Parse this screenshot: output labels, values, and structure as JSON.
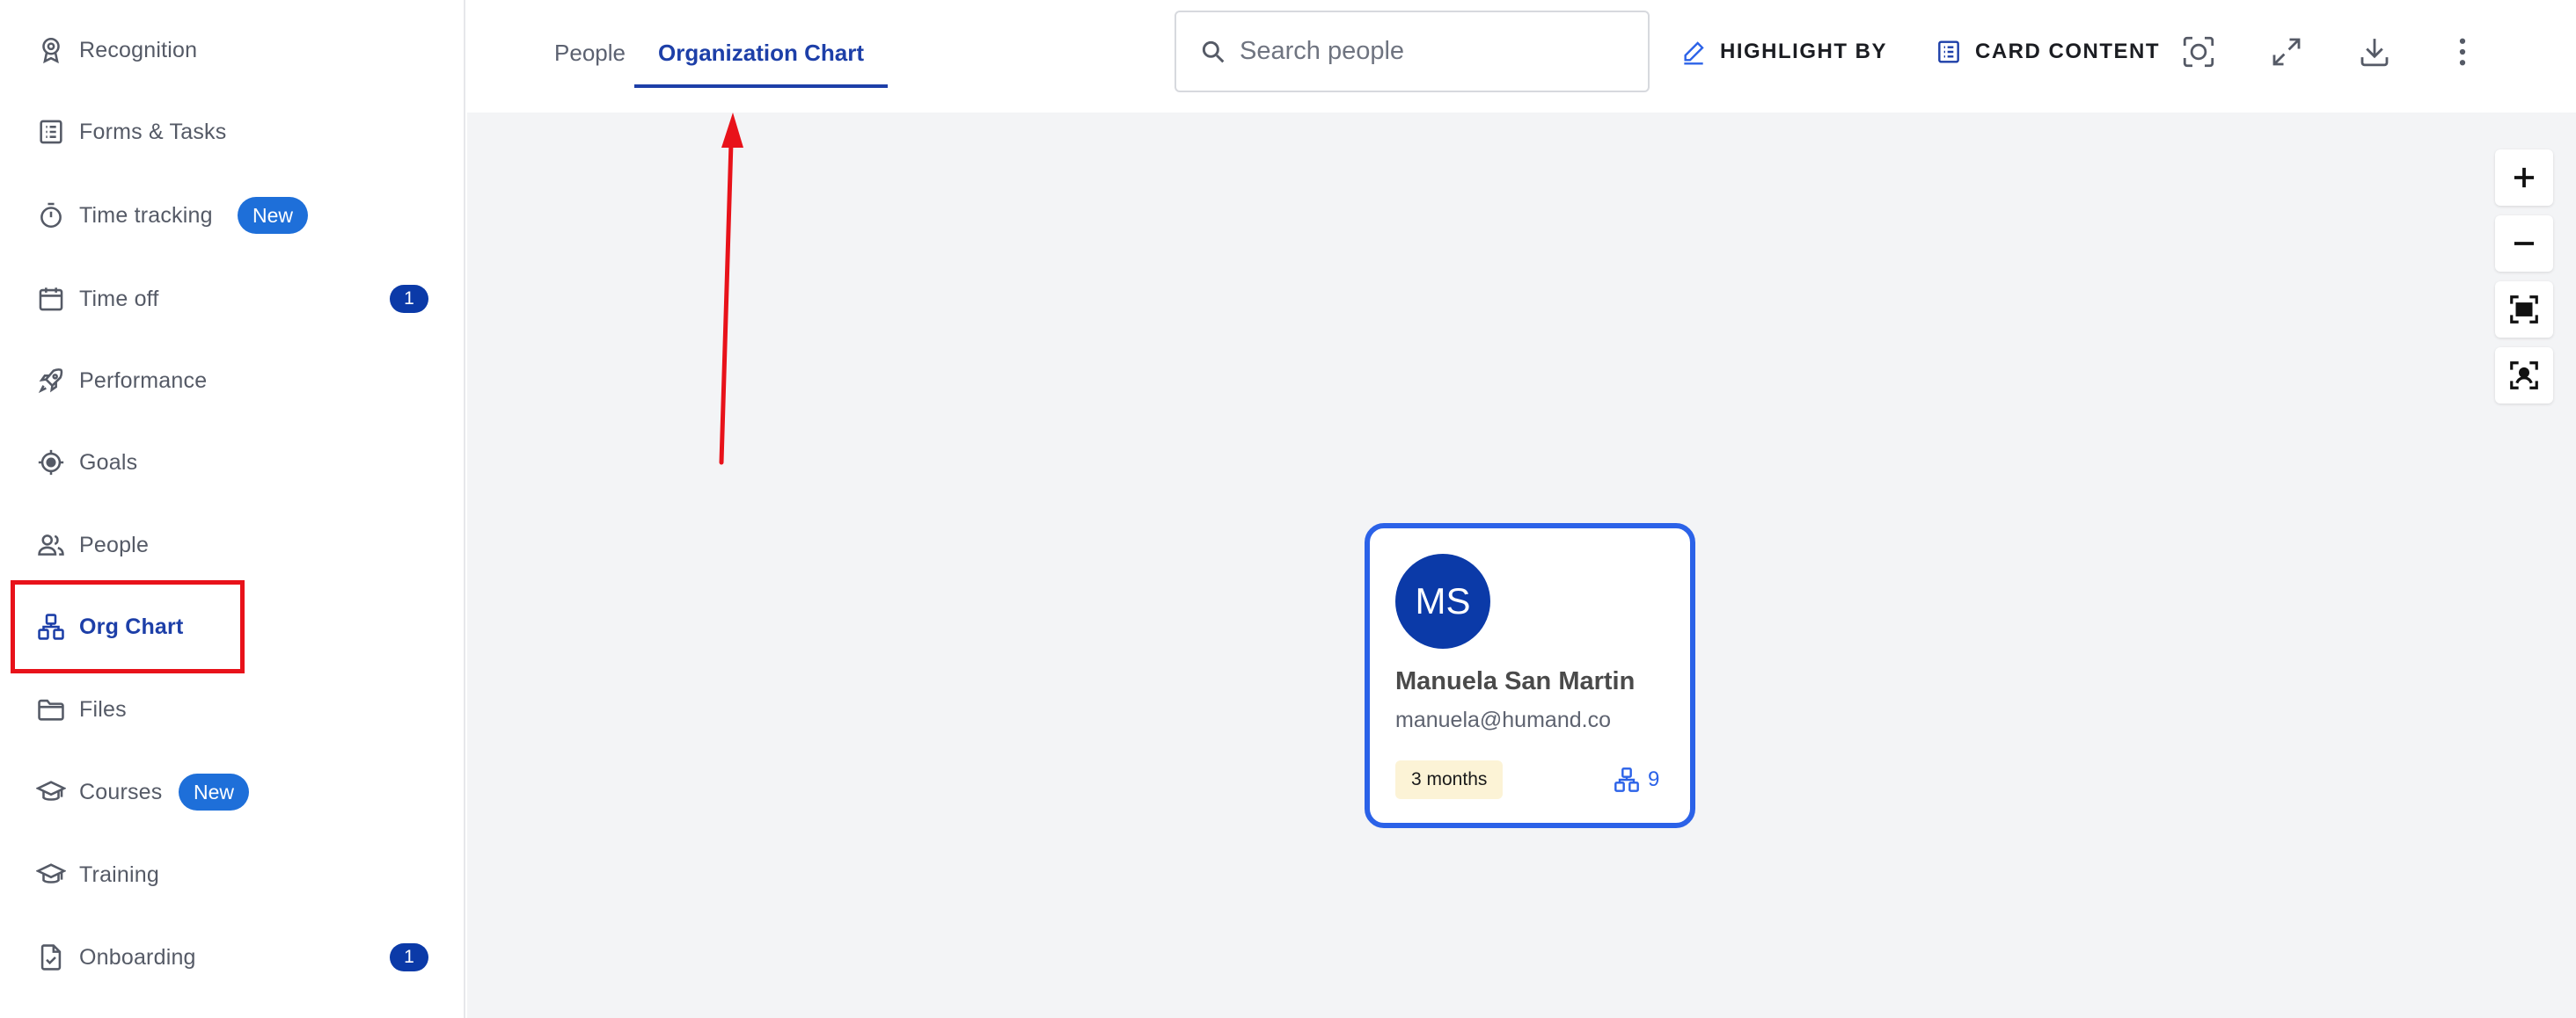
{
  "sidebar": {
    "items": [
      {
        "label": "Recognition",
        "icon": "award-icon"
      },
      {
        "label": "Forms & Tasks",
        "icon": "checklist-icon"
      },
      {
        "label": "Time tracking",
        "icon": "stopwatch-icon",
        "pill": "New"
      },
      {
        "label": "Time off",
        "icon": "calendar-icon",
        "badge": "1"
      },
      {
        "label": "Performance",
        "icon": "rocket-icon"
      },
      {
        "label": "Goals",
        "icon": "target-icon"
      },
      {
        "label": "People",
        "icon": "people-icon"
      },
      {
        "label": "Org Chart",
        "icon": "org-chart-icon",
        "active": true
      },
      {
        "label": "Files",
        "icon": "folder-icon"
      },
      {
        "label": "Courses",
        "icon": "graduation-cap-icon",
        "pill": "New"
      },
      {
        "label": "Training",
        "icon": "graduation-cap-icon"
      },
      {
        "label": "Onboarding",
        "icon": "document-check-icon",
        "badge": "1"
      }
    ]
  },
  "header": {
    "tabs": [
      {
        "label": "People",
        "active": false
      },
      {
        "label": "Organization Chart",
        "active": true
      }
    ],
    "search": {
      "placeholder": "Search people",
      "value": ""
    },
    "highlight_label": "HIGHLIGHT BY",
    "card_content_label": "CARD CONTENT",
    "icons": [
      "focus-icon",
      "expand-icon",
      "download-icon",
      "more-vert-icon"
    ]
  },
  "zoom_controls": [
    "zoom-in-icon",
    "zoom-out-icon",
    "fit-screen-icon",
    "center-person-icon"
  ],
  "card": {
    "initials": "MS",
    "name": "Manuela San Martin",
    "email": "manuela@humand.co",
    "tenure": "3 months",
    "reports_count": "9"
  },
  "colors": {
    "accent": "#1d3fa8",
    "avatar": "#0b3aa8",
    "card_border": "#2b62e8",
    "pill_new": "#1e6fd9",
    "annotation": "#e8121a",
    "canvas": "#f3f4f6",
    "tenure_bg": "#fcf3d6"
  }
}
